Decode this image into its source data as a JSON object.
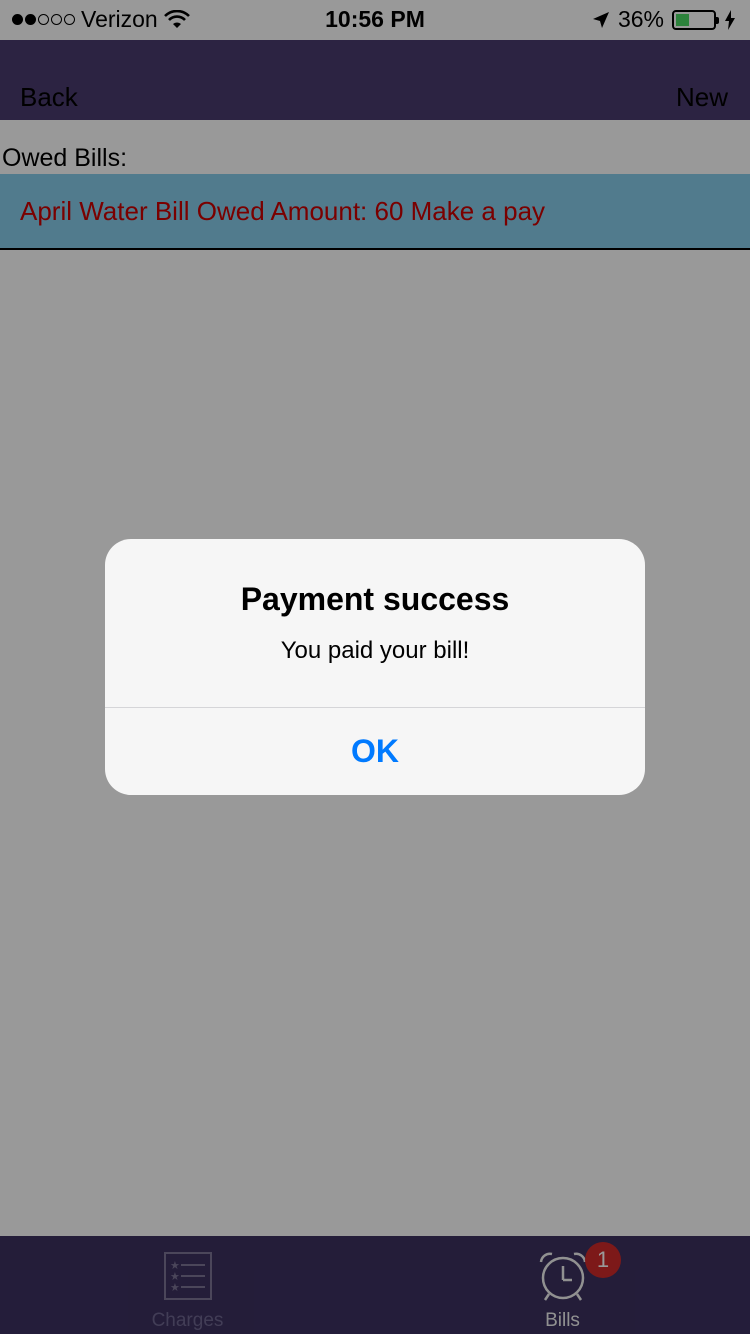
{
  "status_bar": {
    "carrier": "Verizon",
    "time": "10:56 PM",
    "battery_percent": "36%",
    "battery_level": 0.36,
    "signal_bars_filled": 2,
    "signal_bars_total": 5
  },
  "nav": {
    "back_label": "Back",
    "new_label": "New",
    "background": "#4a3b6f"
  },
  "bills": {
    "section_label": "Owed Bills:",
    "items": [
      {
        "text": "April Water Bill Owed Amount: 60 Make a pay"
      }
    ],
    "row_background": "#87ceeb",
    "row_text_color": "#cc0000"
  },
  "tab_bar": {
    "background": "#3c3160",
    "tabs": [
      {
        "label": "Charges",
        "icon": "list-icon",
        "selected": false
      },
      {
        "label": "Bills",
        "icon": "alarm-clock-icon",
        "selected": true,
        "badge": "1"
      }
    ],
    "badge_color": "#d12b2b"
  },
  "alert": {
    "title": "Payment success",
    "message": "You paid your bill!",
    "ok_label": "OK",
    "ok_color": "#007aff"
  }
}
